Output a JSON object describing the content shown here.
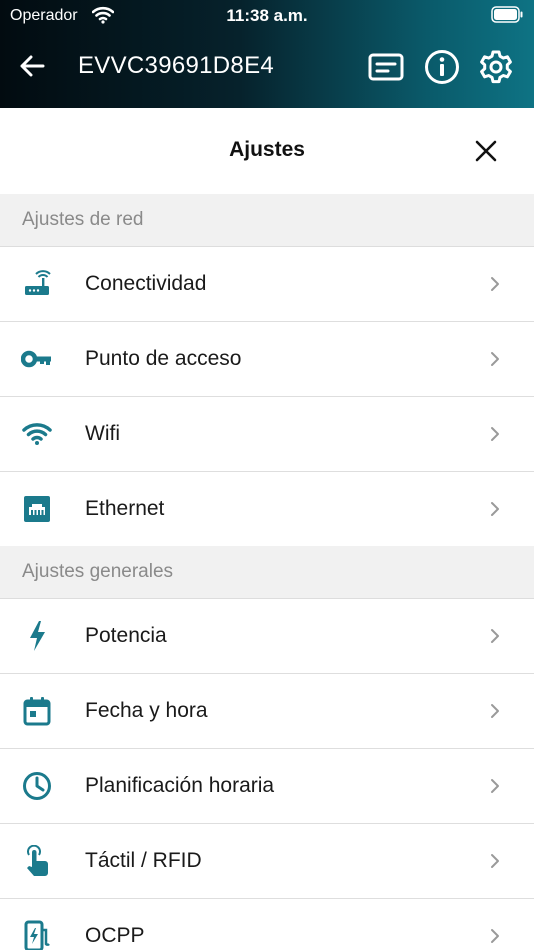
{
  "status_bar": {
    "carrier": "Operador",
    "time": "11:38 a.m."
  },
  "nav": {
    "device_id": "EVVC39691D8E4",
    "icons": [
      "back-arrow-icon",
      "message-icon",
      "info-icon",
      "gear-icon"
    ]
  },
  "sheet": {
    "title": "Ajustes"
  },
  "sections": [
    {
      "title": "Ajustes de red",
      "items": [
        {
          "label": "Conectividad",
          "icon": "router-icon"
        },
        {
          "label": "Punto de acceso",
          "icon": "key-icon"
        },
        {
          "label": "Wifi",
          "icon": "wifi-icon"
        },
        {
          "label": "Ethernet",
          "icon": "ethernet-icon"
        }
      ]
    },
    {
      "title": "Ajustes generales",
      "items": [
        {
          "label": "Potencia",
          "icon": "lightning-icon"
        },
        {
          "label": "Fecha y hora",
          "icon": "calendar-icon"
        },
        {
          "label": "Planificación horaria",
          "icon": "clock-icon"
        },
        {
          "label": "Táctil / RFID",
          "icon": "touch-icon"
        },
        {
          "label": "OCPP",
          "icon": "charger-icon"
        }
      ]
    }
  ],
  "colors": {
    "accent": "#1b7a8c",
    "section_bg": "#f1f1f1",
    "section_text": "#8a8a8a"
  }
}
